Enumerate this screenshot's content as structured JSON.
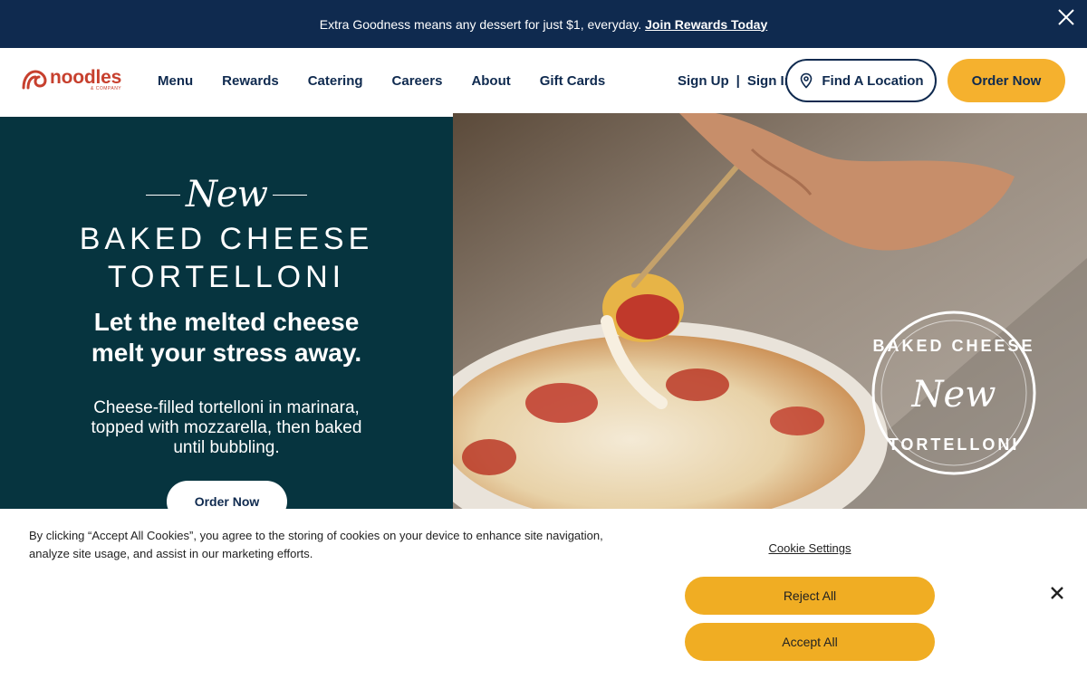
{
  "promo": {
    "message": "Extra Goodness means any dessert for just $1, everyday.",
    "link": "Join Rewards Today",
    "close_icon": "close-icon"
  },
  "brand": {
    "name": "noodles",
    "sub": "& COMPANY",
    "color": "#c7402e"
  },
  "nav": {
    "items": [
      "Menu",
      "Rewards",
      "Catering",
      "Careers",
      "About",
      "Gift Cards"
    ]
  },
  "auth": {
    "sign_up": "Sign Up",
    "separator": "|",
    "sign_in": "Sign In"
  },
  "header_actions": {
    "find_location": "Find A Location",
    "location_icon": "location-pin-icon",
    "order_now": "Order Now"
  },
  "hero": {
    "new_label": "New",
    "product_line1": "BAKED CHEESE",
    "product_line2": "TORTELLONI",
    "headline_line1": "Let the melted cheese",
    "headline_line2": "melt your stress away.",
    "description": "Cheese-filled tortelloni in marinara, topped with mozzarella, then baked until bubbling.",
    "cta": "Order Now",
    "badge_top": "BAKED CHEESE",
    "badge_middle": "New",
    "badge_bottom": "TORTELLONI"
  },
  "cookie": {
    "text": "By clicking “Accept All Cookies”, you agree to the storing of cookies on your device to enhance site navigation, analyze site usage, and assist in our marketing efforts.",
    "settings": "Cookie Settings",
    "reject": "Reject All",
    "accept": "Accept All",
    "close_icon": "close-icon"
  },
  "colors": {
    "navy": "#0f2a4f",
    "teal": "#06343f",
    "gold": "#f5b12e",
    "cookie_gold": "#f0ad23"
  }
}
